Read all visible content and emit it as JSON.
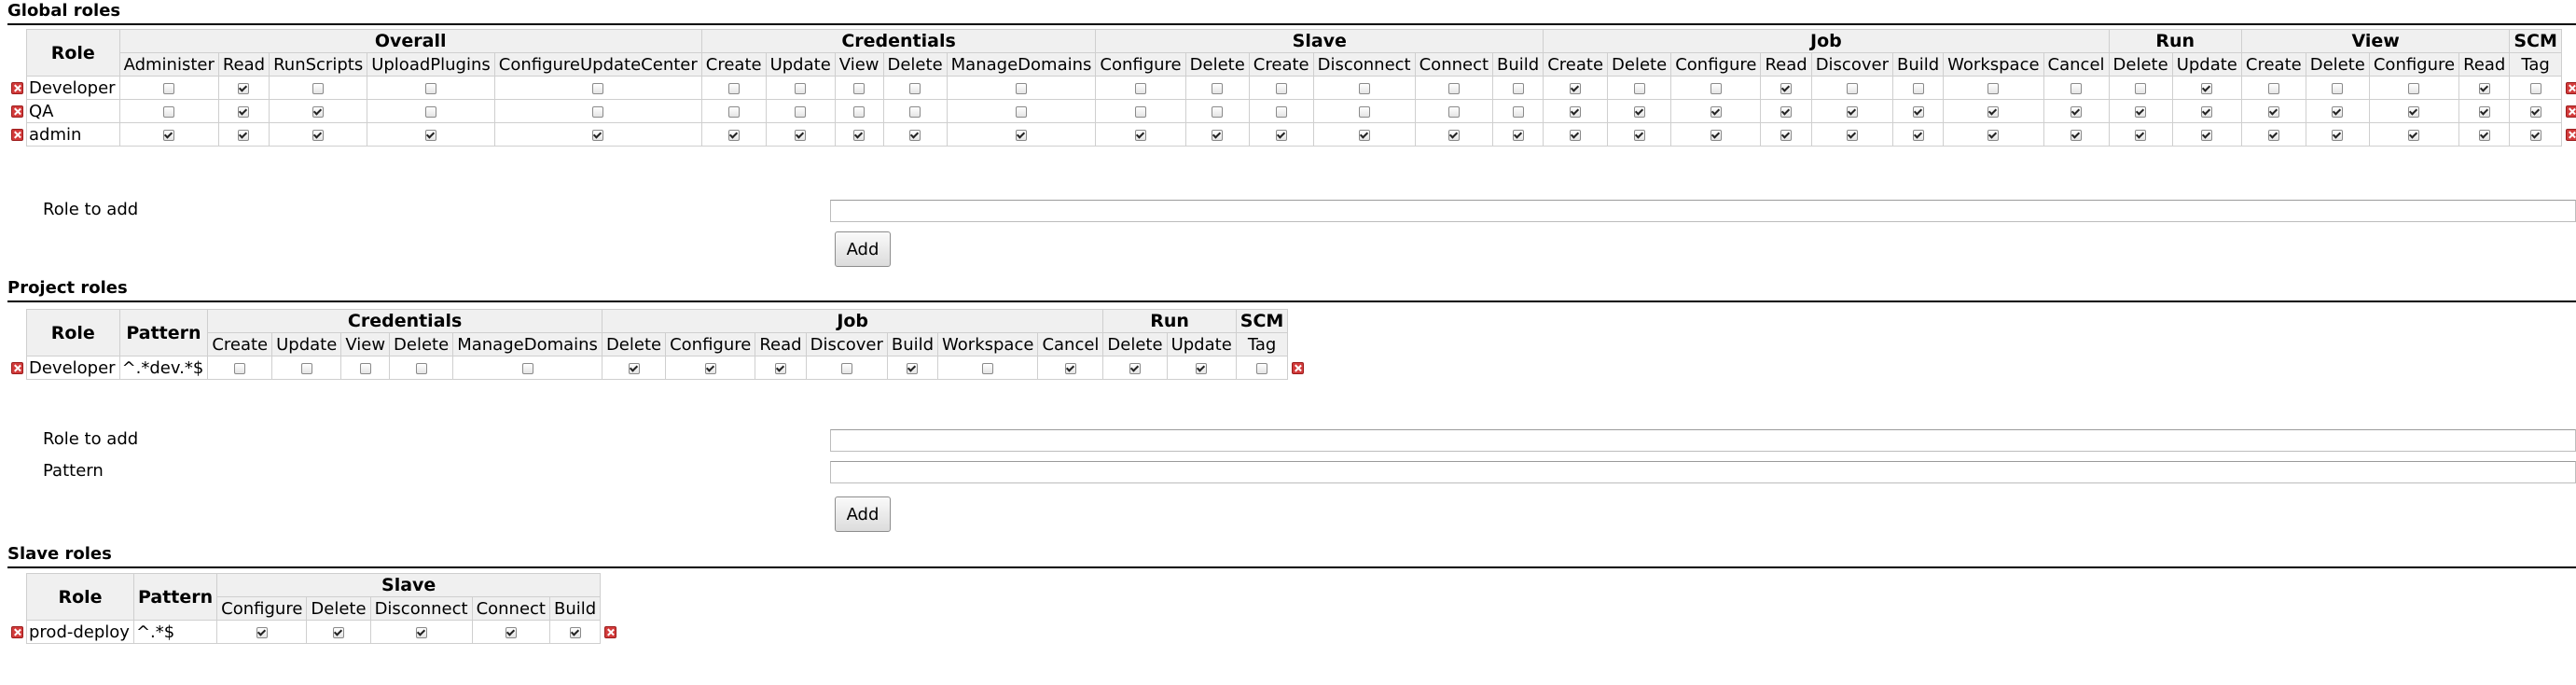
{
  "sections": {
    "global_title": "Global roles",
    "project_title": "Project roles",
    "slave_title": "Slave roles"
  },
  "labels": {
    "role": "Role",
    "pattern": "Pattern",
    "role_to_add": "Role to add",
    "pattern_field": "Pattern",
    "add": "Add"
  },
  "global": {
    "groups": [
      {
        "name": "Overall",
        "perms": [
          "Administer",
          "Read",
          "RunScripts",
          "UploadPlugins",
          "ConfigureUpdateCenter"
        ]
      },
      {
        "name": "Credentials",
        "perms": [
          "Create",
          "Update",
          "View",
          "Delete",
          "ManageDomains"
        ]
      },
      {
        "name": "Slave",
        "perms": [
          "Configure",
          "Delete",
          "Create",
          "Disconnect",
          "Connect",
          "Build"
        ]
      },
      {
        "name": "Job",
        "perms": [
          "Create",
          "Delete",
          "Configure",
          "Read",
          "Discover",
          "Build",
          "Workspace",
          "Cancel"
        ]
      },
      {
        "name": "Run",
        "perms": [
          "Delete",
          "Update"
        ]
      },
      {
        "name": "View",
        "perms": [
          "Create",
          "Delete",
          "Configure",
          "Read"
        ]
      },
      {
        "name": "SCM",
        "perms": [
          "Tag"
        ]
      }
    ],
    "roles": [
      {
        "name": "Developer",
        "checks": [
          0,
          1,
          0,
          0,
          0,
          0,
          0,
          0,
          0,
          0,
          0,
          0,
          0,
          0,
          0,
          0,
          1,
          0,
          0,
          1,
          0,
          0,
          0,
          0,
          0,
          1,
          0,
          0,
          0,
          1,
          0
        ]
      },
      {
        "name": "QA",
        "checks": [
          0,
          1,
          1,
          0,
          0,
          0,
          0,
          0,
          0,
          0,
          0,
          0,
          0,
          0,
          0,
          0,
          1,
          1,
          1,
          1,
          1,
          1,
          1,
          1,
          1,
          1,
          1,
          1,
          1,
          1,
          1
        ]
      },
      {
        "name": "admin",
        "checks": [
          1,
          1,
          1,
          1,
          1,
          1,
          1,
          1,
          1,
          1,
          1,
          1,
          1,
          1,
          1,
          1,
          1,
          1,
          1,
          1,
          1,
          1,
          1,
          1,
          1,
          1,
          1,
          1,
          1,
          1,
          1
        ]
      }
    ],
    "role_to_add_value": ""
  },
  "project": {
    "groups": [
      {
        "name": "Credentials",
        "perms": [
          "Create",
          "Update",
          "View",
          "Delete",
          "ManageDomains"
        ]
      },
      {
        "name": "Job",
        "perms": [
          "Delete",
          "Configure",
          "Read",
          "Discover",
          "Build",
          "Workspace",
          "Cancel"
        ]
      },
      {
        "name": "Run",
        "perms": [
          "Delete",
          "Update"
        ]
      },
      {
        "name": "SCM",
        "perms": [
          "Tag"
        ]
      }
    ],
    "roles": [
      {
        "name": "Developer",
        "pattern": "^.*dev.*$",
        "checks": [
          0,
          0,
          0,
          0,
          0,
          1,
          1,
          1,
          0,
          1,
          0,
          1,
          1,
          1,
          0
        ]
      }
    ],
    "role_to_add_value": "",
    "pattern_value": ""
  },
  "slave": {
    "groups": [
      {
        "name": "Slave",
        "perms": [
          "Configure",
          "Delete",
          "Disconnect",
          "Connect",
          "Build"
        ]
      }
    ],
    "roles": [
      {
        "name": "prod-deploy",
        "pattern": "^.*$",
        "checks": [
          1,
          1,
          1,
          1,
          1
        ]
      }
    ]
  }
}
